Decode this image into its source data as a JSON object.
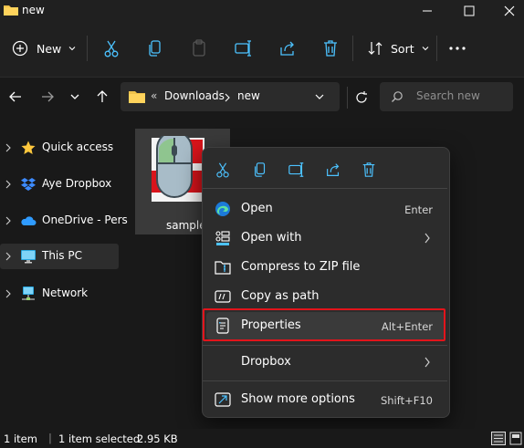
{
  "window": {
    "title": "new"
  },
  "toolbar": {
    "new_label": "New",
    "sort_label": "Sort"
  },
  "address": {
    "overflow": "«",
    "crumbs": [
      "Downloads",
      "new"
    ]
  },
  "search": {
    "placeholder": "Search new"
  },
  "sidebar": {
    "items": [
      {
        "label": "Quick access",
        "icon": "star-icon",
        "selected": false
      },
      {
        "label": "Aye Dropbox",
        "icon": "dropbox-icon",
        "selected": false
      },
      {
        "label": "OneDrive - Pers",
        "icon": "cloud-icon",
        "selected": false
      },
      {
        "label": "This PC",
        "icon": "monitor-icon",
        "selected": true
      },
      {
        "label": "Network",
        "icon": "network-icon",
        "selected": false
      }
    ]
  },
  "file": {
    "name": "sample"
  },
  "context_menu": {
    "items": [
      {
        "label": "Open",
        "shortcut": "Enter",
        "icon": "edge-icon"
      },
      {
        "label": "Open with",
        "shortcut": "",
        "icon": "open-with-icon",
        "submenu": true
      },
      {
        "label": "Compress to ZIP file",
        "shortcut": "",
        "icon": "zip-icon"
      },
      {
        "label": "Copy as path",
        "shortcut": "",
        "icon": "copy-path-icon"
      },
      {
        "label": "Properties",
        "shortcut": "Alt+Enter",
        "icon": "properties-icon",
        "highlighted": true
      }
    ],
    "dropbox": {
      "label": "Dropbox"
    },
    "more": {
      "label": "Show more options",
      "shortcut": "Shift+F10"
    }
  },
  "status": {
    "count": "1 item",
    "selected": "1 item selected",
    "size": "2.95 KB"
  },
  "colors": {
    "background": "#191919",
    "chrome": "#202020",
    "menu": "#2c2c2c",
    "highlight": "#e2141b",
    "accent": "#4cc2ff"
  }
}
